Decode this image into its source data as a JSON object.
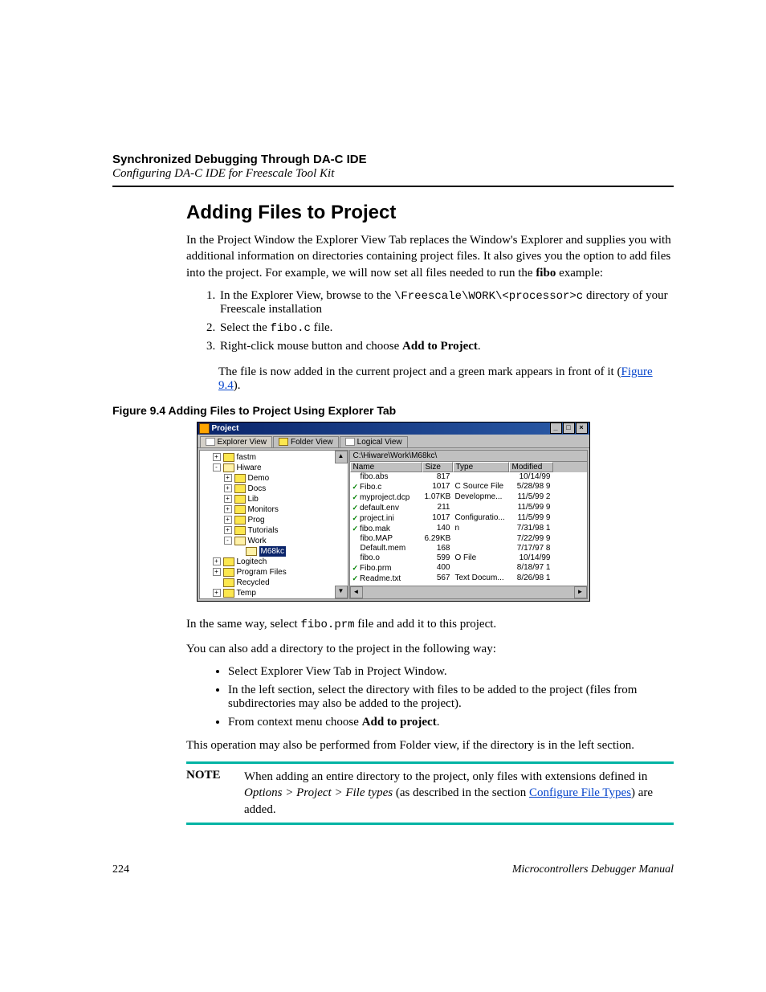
{
  "header": {
    "chapter": "Synchronized Debugging Through DA-C IDE",
    "subtitle": "Configuring DA-C IDE for Freescale Tool Kit"
  },
  "title": "Adding Files to Project",
  "intro": "In the Project Window the Explorer View Tab replaces the Window's Explorer and supplies you with additional information on directories containing project files. It also gives you the option to add files into the project. For example, we will now set all files needed to run the ",
  "intro_bold": "fibo",
  "intro_suffix": " example:",
  "steps": {
    "s1a": "In the Explorer View, browse to the ",
    "s1code": "\\Freescale\\WORK\\<processor>c",
    "s1b": " directory of your Freescale installation",
    "s2a": "Select the ",
    "s2code": "fibo.c",
    "s2b": " file.",
    "s3a": "Right-click mouse button and choose ",
    "s3bold": "Add to Project",
    "s3b": "."
  },
  "added_line_a": "The file is now added in the current project and a green mark appears in front of it (",
  "added_link": "Figure 9.4",
  "added_line_b": ").",
  "figure_caption": "Figure 9.4  Adding Files to Project Using Explorer Tab",
  "win": {
    "title": "Project",
    "tabs": [
      "Explorer View",
      "Folder View",
      "Logical View"
    ],
    "path": "C:\\Hiware\\Work\\M68kc\\",
    "cols": [
      "Name",
      "Size",
      "Type",
      "Modified"
    ],
    "tree": [
      {
        "level": 1,
        "toggle": "+",
        "label": "fastm"
      },
      {
        "level": 1,
        "toggle": "-",
        "open": true,
        "label": "Hiware"
      },
      {
        "level": 2,
        "toggle": "+",
        "label": "Demo"
      },
      {
        "level": 2,
        "toggle": "+",
        "label": "Docs"
      },
      {
        "level": 2,
        "toggle": "+",
        "label": "Lib"
      },
      {
        "level": 2,
        "toggle": "+",
        "label": "Monitors"
      },
      {
        "level": 2,
        "toggle": "+",
        "label": "Prog"
      },
      {
        "level": 2,
        "toggle": "+",
        "label": "Tutorials"
      },
      {
        "level": 2,
        "toggle": "-",
        "open": true,
        "label": "Work"
      },
      {
        "level": 3,
        "toggle": "",
        "open": true,
        "label": "M68kc",
        "selected": true
      },
      {
        "level": 1,
        "toggle": "+",
        "label": "Logitech"
      },
      {
        "level": 1,
        "toggle": "+",
        "label": "Program Files"
      },
      {
        "level": 1,
        "toggle": "",
        "label": "Recycled"
      },
      {
        "level": 1,
        "toggle": "+",
        "label": "Temp"
      }
    ],
    "rows": [
      {
        "check": false,
        "name": "fibo.abs",
        "size": "817",
        "type": "",
        "mod": "10/14/99"
      },
      {
        "check": true,
        "name": "Fibo.c",
        "size": "1017",
        "type": "C Source File",
        "mod": "5/28/98 9"
      },
      {
        "check": true,
        "name": "myproject.dcp",
        "size": "1.07KB",
        "type": "Developme...",
        "mod": "11/5/99 2"
      },
      {
        "check": true,
        "name": "default.env",
        "size": "211",
        "type": "",
        "mod": "11/5/99 9"
      },
      {
        "check": true,
        "name": "project.ini",
        "size": "1017",
        "type": "Configuratio...",
        "mod": "11/5/99 9"
      },
      {
        "check": true,
        "name": "fibo.mak",
        "size": "140",
        "type": "n",
        "mod": "7/31/98 1"
      },
      {
        "check": false,
        "name": "fibo.MAP",
        "size": "6.29KB",
        "type": "",
        "mod": "7/22/99 9"
      },
      {
        "check": false,
        "name": "Default.mem",
        "size": "168",
        "type": "",
        "mod": "7/17/97 8"
      },
      {
        "check": false,
        "name": "fibo.o",
        "size": "599",
        "type": "O File",
        "mod": "10/14/99"
      },
      {
        "check": true,
        "name": "Fibo.prm",
        "size": "400",
        "type": "",
        "mod": "8/18/97 1"
      },
      {
        "check": true,
        "name": "Readme.txt",
        "size": "567",
        "type": "Text Docum...",
        "mod": "8/26/98 1"
      }
    ]
  },
  "after1a": "In the same way, select ",
  "after1code": "fibo.prm",
  "after1b": " file and add it to this project.",
  "after2": "You can also add a directory to the project in the following way:",
  "bullets": {
    "b1": "Select Explorer View Tab in Project Window.",
    "b2": "In the left section, select the directory with files to be added to the project (files from subdirectories may also be added to the project).",
    "b3a": "From context menu choose ",
    "b3bold": "Add to project",
    "b3b": "."
  },
  "after3": "This operation may also be performed from Folder view, if the directory is in the left section.",
  "note": {
    "label": "NOTE",
    "l1": "When adding an entire directory to the project, only files with extensions defined in ",
    "l1_it": "Options > Project > File types",
    "l2a": " (as described in the section ",
    "l2link": "Configure File Types",
    "l2b": ") are added."
  },
  "footer": {
    "page": "224",
    "book": "Microcontrollers Debugger Manual"
  }
}
